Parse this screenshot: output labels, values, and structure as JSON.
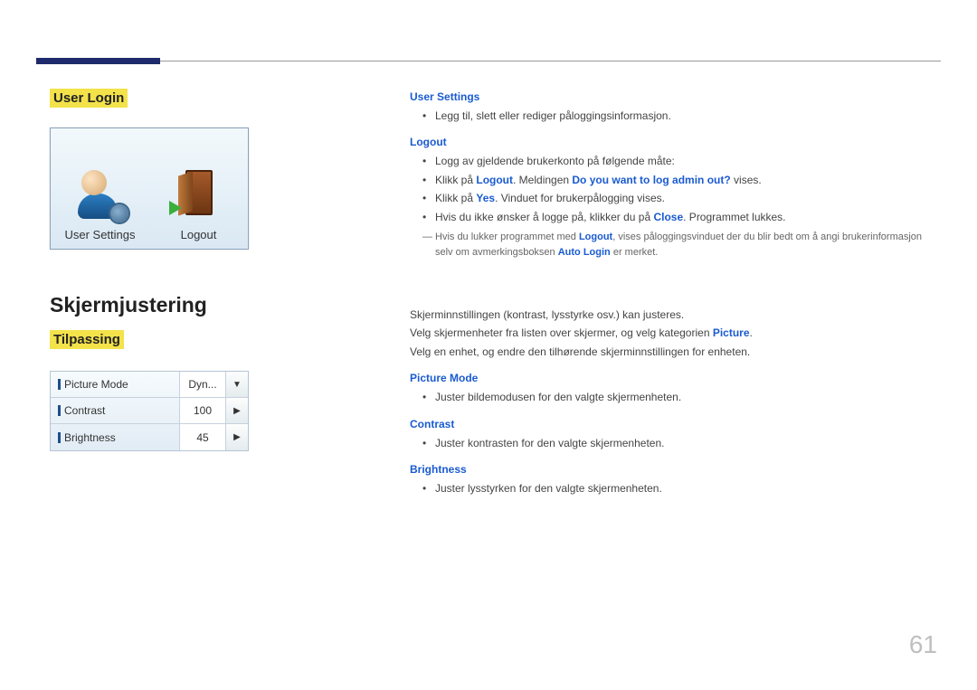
{
  "page_number": "61",
  "section1": {
    "title": "User Login",
    "panel": {
      "user_settings_label": "User Settings",
      "logout_label": "Logout"
    },
    "right": {
      "h_user_settings": "User Settings",
      "b_user_settings": "Legg til, slett eller rediger påloggingsinformasjon.",
      "h_logout": "Logout",
      "b_logout_1": "Logg av gjeldende brukerkonto på følgende måte:",
      "b_logout_2_pre": "Klikk på ",
      "b_logout_2_kw1": "Logout",
      "b_logout_2_mid": ". Meldingen ",
      "b_logout_2_kw2": "Do you want to log admin out?",
      "b_logout_2_post": " vises.",
      "b_logout_3_pre": "Klikk på ",
      "b_logout_3_kw": "Yes",
      "b_logout_3_post": ". Vinduet for brukerpålogging vises.",
      "b_logout_4_pre": "Hvis du ikke ønsker å logge på, klikker du på ",
      "b_logout_4_kw": "Close",
      "b_logout_4_post": ". Programmet lukkes.",
      "note_pre": "Hvis du lukker programmet med ",
      "note_kw1": "Logout",
      "note_mid": ", vises påloggingsvinduet der du blir bedt om å angi brukerinformasjon selv om avmerkingsboksen ",
      "note_kw2": "Auto Login",
      "note_post": " er merket."
    }
  },
  "section2": {
    "heading": "Skjermjustering",
    "subheading": "Tilpassing",
    "panel": {
      "rows": [
        {
          "label": "Picture Mode",
          "value": "Dyn...",
          "btn": "▼"
        },
        {
          "label": "Contrast",
          "value": "100",
          "btn": "▶"
        },
        {
          "label": "Brightness",
          "value": "45",
          "btn": "▶"
        }
      ]
    },
    "right": {
      "p1": "Skjerminnstillingen (kontrast, lysstyrke osv.) kan justeres.",
      "p2_pre": "Velg skjermenheter fra listen over skjermer, og velg kategorien ",
      "p2_kw": "Picture",
      "p2_post": ".",
      "p3": "Velg en enhet, og endre den tilhørende skjerminnstillingen for enheten.",
      "h_picture_mode": "Picture Mode",
      "b_picture_mode": "Juster bildemodusen for den valgte skjermenheten.",
      "h_contrast": "Contrast",
      "b_contrast": "Juster kontrasten for den valgte skjermenheten.",
      "h_brightness": "Brightness",
      "b_brightness": "Juster lysstyrken for den valgte skjermenheten."
    }
  }
}
